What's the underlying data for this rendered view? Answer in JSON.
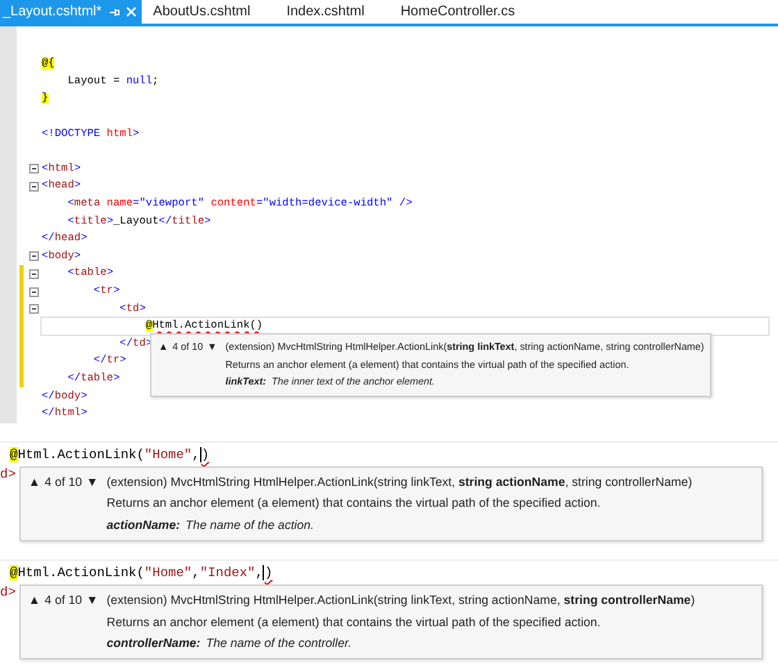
{
  "tabs": [
    {
      "label": "_Layout.cshtml*",
      "selected": true
    },
    {
      "label": "AboutUs.cshtml",
      "selected": false
    },
    {
      "label": "Index.cshtml",
      "selected": false
    },
    {
      "label": "HomeController.cs",
      "selected": false
    }
  ],
  "editor": {
    "lines": [
      {
        "kind": "code",
        "tokens": [
          {
            "kind": "razor",
            "text": "@{"
          }
        ],
        "foldable": false,
        "changed": false,
        "current": false
      },
      {
        "kind": "code",
        "tokens": [
          {
            "kind": "plain",
            "text": "    Layout = "
          },
          {
            "kind": "keyword",
            "text": "null"
          },
          {
            "kind": "plain",
            "text": ";"
          }
        ],
        "foldable": false,
        "changed": false,
        "current": false
      },
      {
        "kind": "code",
        "tokens": [
          {
            "kind": "razor",
            "text": "}"
          }
        ],
        "foldable": false,
        "changed": false,
        "current": false
      },
      {
        "kind": "blank",
        "foldable": false,
        "changed": false,
        "current": false
      },
      {
        "kind": "code",
        "tokens": [
          {
            "kind": "punct",
            "text": "<!DOCTYPE "
          },
          {
            "kind": "attr",
            "text": "html"
          },
          {
            "kind": "punct",
            "text": ">"
          }
        ],
        "foldable": false,
        "changed": false,
        "current": false
      },
      {
        "kind": "blank",
        "foldable": false,
        "changed": false,
        "current": false
      },
      {
        "kind": "code",
        "tokens": [
          {
            "kind": "punct",
            "text": "<"
          },
          {
            "kind": "tag",
            "text": "html"
          },
          {
            "kind": "punct",
            "text": ">"
          }
        ],
        "foldable": true,
        "changed": false,
        "current": false
      },
      {
        "kind": "code",
        "tokens": [
          {
            "kind": "punct",
            "text": "<"
          },
          {
            "kind": "tag",
            "text": "head"
          },
          {
            "kind": "punct",
            "text": ">"
          }
        ],
        "foldable": true,
        "changed": false,
        "current": false
      },
      {
        "kind": "code",
        "tokens": [
          {
            "kind": "punct",
            "text": "    <"
          },
          {
            "kind": "tag",
            "text": "meta"
          },
          {
            "kind": "attr",
            "text": " name"
          },
          {
            "kind": "punct",
            "text": "="
          },
          {
            "kind": "value",
            "text": "\"viewport\""
          },
          {
            "kind": "attr",
            "text": " content"
          },
          {
            "kind": "punct",
            "text": "="
          },
          {
            "kind": "value",
            "text": "\"width=device-width\""
          },
          {
            "kind": "punct",
            "text": " />"
          }
        ],
        "foldable": false,
        "changed": false,
        "current": false
      },
      {
        "kind": "code",
        "tokens": [
          {
            "kind": "punct",
            "text": "    <"
          },
          {
            "kind": "tag",
            "text": "title"
          },
          {
            "kind": "punct",
            "text": ">"
          },
          {
            "kind": "plain",
            "text": "_Layout"
          },
          {
            "kind": "punct",
            "text": "</"
          },
          {
            "kind": "tag",
            "text": "title"
          },
          {
            "kind": "punct",
            "text": ">"
          }
        ],
        "foldable": false,
        "changed": false,
        "current": false
      },
      {
        "kind": "code",
        "tokens": [
          {
            "kind": "punct",
            "text": "</"
          },
          {
            "kind": "tag",
            "text": "head"
          },
          {
            "kind": "punct",
            "text": ">"
          }
        ],
        "foldable": false,
        "changed": false,
        "current": false
      },
      {
        "kind": "code",
        "tokens": [
          {
            "kind": "punct",
            "text": "<"
          },
          {
            "kind": "tag",
            "text": "body"
          },
          {
            "kind": "punct",
            "text": ">"
          }
        ],
        "foldable": true,
        "changed": false,
        "current": false
      },
      {
        "kind": "code",
        "tokens": [
          {
            "kind": "punct",
            "text": "    <"
          },
          {
            "kind": "tag",
            "text": "table"
          },
          {
            "kind": "punct",
            "text": ">"
          }
        ],
        "foldable": true,
        "changed": true,
        "current": false
      },
      {
        "kind": "code",
        "tokens": [
          {
            "kind": "punct",
            "text": "        <"
          },
          {
            "kind": "tag",
            "text": "tr"
          },
          {
            "kind": "punct",
            "text": ">"
          }
        ],
        "foldable": true,
        "changed": true,
        "current": false
      },
      {
        "kind": "code",
        "tokens": [
          {
            "kind": "punct",
            "text": "            <"
          },
          {
            "kind": "tag",
            "text": "td"
          },
          {
            "kind": "punct",
            "text": ">"
          }
        ],
        "foldable": true,
        "changed": true,
        "current": false
      },
      {
        "kind": "code",
        "tokens": [
          {
            "kind": "razor",
            "text": "                @"
          },
          {
            "kind": "error",
            "text": "Html.ActionLink()"
          }
        ],
        "foldable": false,
        "changed": true,
        "current": true
      },
      {
        "kind": "code",
        "tokens": [
          {
            "kind": "punct",
            "text": "            </"
          },
          {
            "kind": "tag",
            "text": "td"
          },
          {
            "kind": "punct",
            "text": ">"
          }
        ],
        "foldable": false,
        "changed": true,
        "current": false
      },
      {
        "kind": "code",
        "tokens": [
          {
            "kind": "punct",
            "text": "        </"
          },
          {
            "kind": "tag",
            "text": "tr"
          },
          {
            "kind": "punct",
            "text": ">"
          }
        ],
        "foldable": false,
        "changed": true,
        "current": false
      },
      {
        "kind": "code",
        "tokens": [
          {
            "kind": "punct",
            "text": "    </"
          },
          {
            "kind": "tag",
            "text": "table"
          },
          {
            "kind": "punct",
            "text": ">"
          }
        ],
        "foldable": false,
        "changed": true,
        "current": false
      },
      {
        "kind": "code",
        "tokens": [
          {
            "kind": "punct",
            "text": "</"
          },
          {
            "kind": "tag",
            "text": "body"
          },
          {
            "kind": "punct",
            "text": ">"
          }
        ],
        "foldable": false,
        "changed": false,
        "current": false
      },
      {
        "kind": "code",
        "tokens": [
          {
            "kind": "punct",
            "text": "</"
          },
          {
            "kind": "tag",
            "text": "html"
          },
          {
            "kind": "punct",
            "text": ">"
          }
        ],
        "foldable": false,
        "changed": false,
        "current": false
      }
    ],
    "tooltip": {
      "up": "▲",
      "counter": "4 of 10",
      "down": "▼",
      "signature": "(extension) MvcHtmlString HtmlHelper.ActionLink(**string linkText**, string actionName, string controllerName)",
      "description": "Returns an anchor element (a element) that contains the virtual path of the specified action.",
      "param_name": "linkText:",
      "param_description": "The inner text of the anchor element."
    }
  },
  "snippets": [
    {
      "tokens": [
        {
          "kind": "razor",
          "text": "@"
        },
        {
          "kind": "plain",
          "text": "Html.ActionLink("
        },
        {
          "kind": "string",
          "text": "\"Home\""
        },
        {
          "kind": "plain",
          "text": ","
        },
        {
          "kind": "caret"
        },
        {
          "kind": "error",
          "text": ")"
        }
      ],
      "fragment": "d>",
      "tooltip": {
        "up": "▲",
        "counter": "4 of 10",
        "down": "▼",
        "signature": "(extension) MvcHtmlString HtmlHelper.ActionLink(string linkText, **string actionName**, string controllerName)",
        "description": "Returns an anchor element (a element) that contains the virtual path of the specified action.",
        "param_name": "actionName:",
        "param_description": "The name of the action."
      }
    },
    {
      "tokens": [
        {
          "kind": "razor",
          "text": "@"
        },
        {
          "kind": "plain",
          "text": "Html.ActionLink("
        },
        {
          "kind": "string",
          "text": "\"Home\""
        },
        {
          "kind": "plain",
          "text": ","
        },
        {
          "kind": "string",
          "text": "\"Index\""
        },
        {
          "kind": "plain",
          "text": ","
        },
        {
          "kind": "caret"
        },
        {
          "kind": "error",
          "text": ")"
        }
      ],
      "fragment": "d>",
      "tooltip": {
        "up": "▲",
        "counter": "4 of 10",
        "down": "▼",
        "signature": "(extension) MvcHtmlString HtmlHelper.ActionLink(string linkText, string actionName, **string controllerName**)",
        "description": "Returns an anchor element (a element) that contains the virtual path of the specified action.",
        "param_name": "controllerName:",
        "param_description": "The name of the controller."
      }
    }
  ]
}
